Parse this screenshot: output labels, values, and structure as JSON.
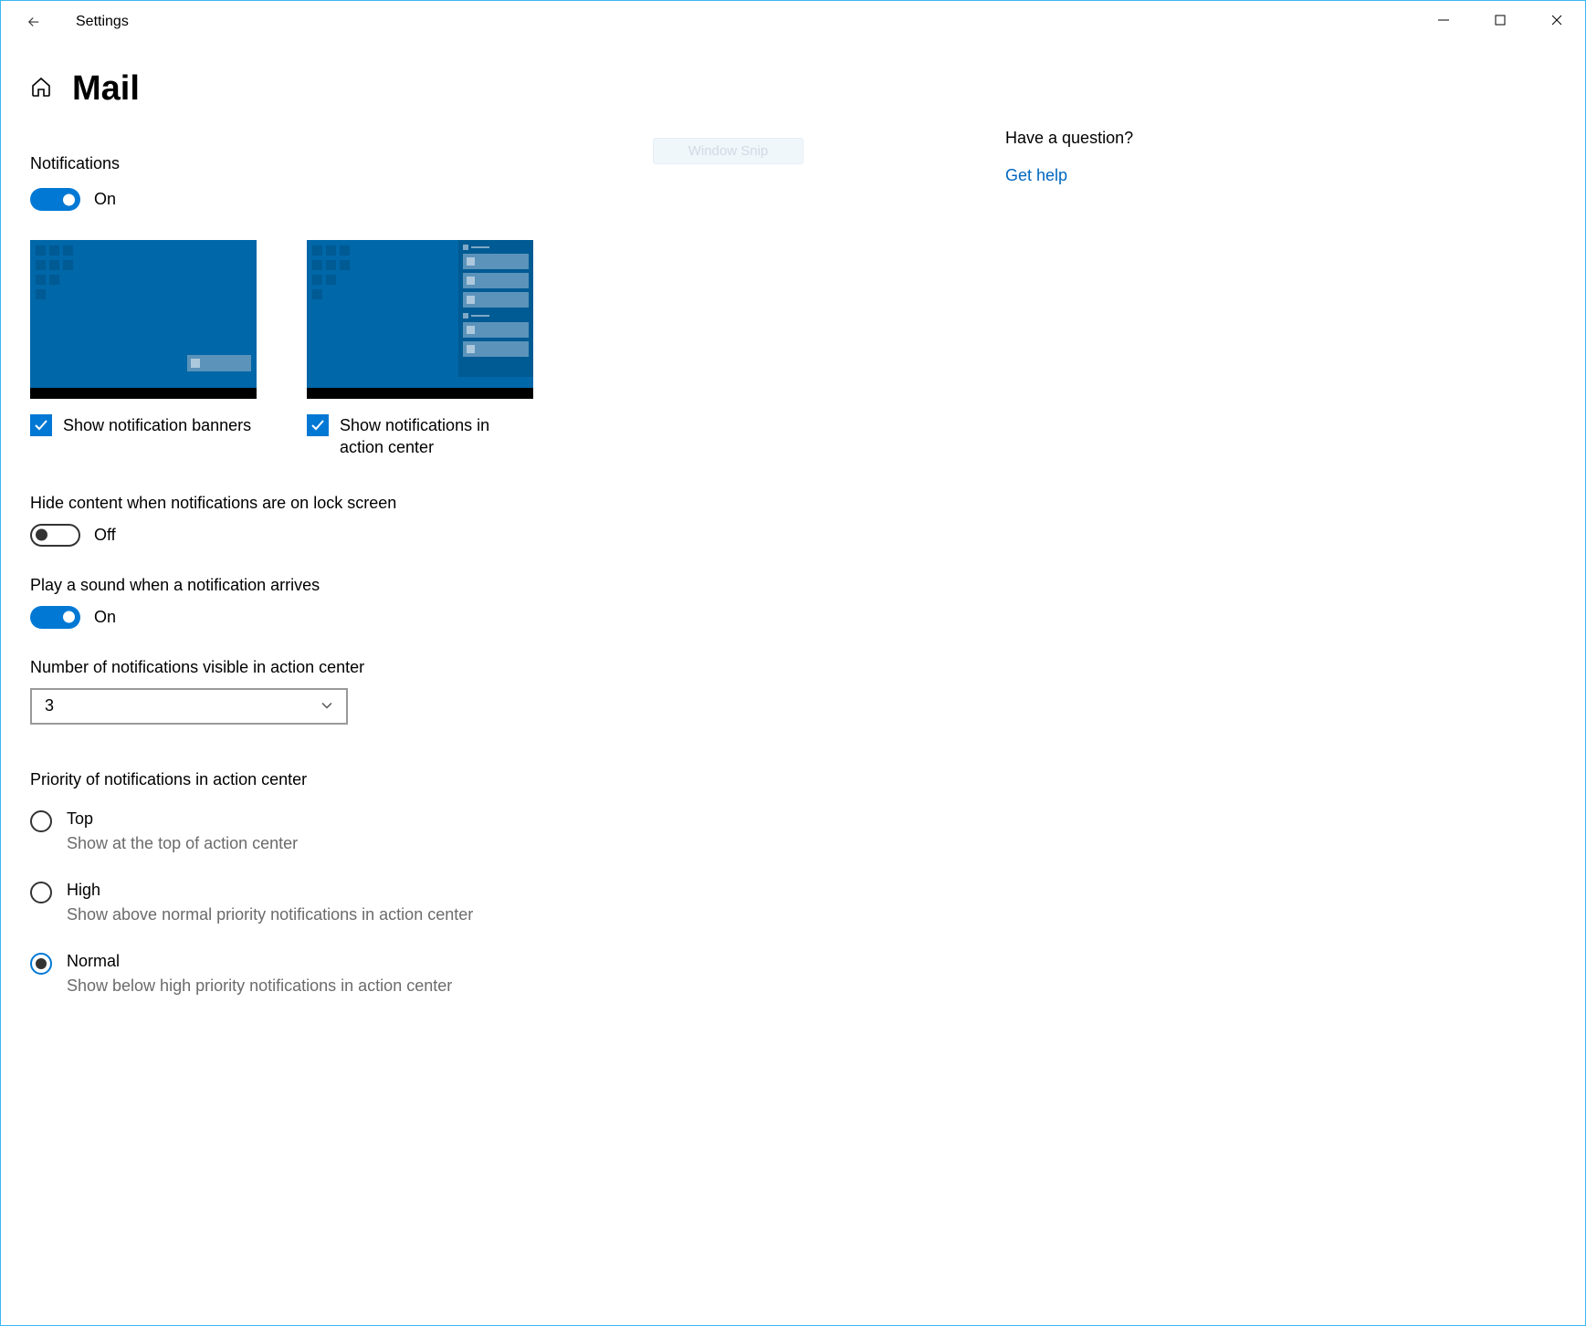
{
  "window": {
    "title": "Settings"
  },
  "page": {
    "title": "Mail"
  },
  "notifications": {
    "heading": "Notifications",
    "toggle_state": "On",
    "show_banners_label": "Show notification banners",
    "show_action_center_label": "Show notifications in action center"
  },
  "hide_content": {
    "label": "Hide content when notifications are on lock screen",
    "state": "Off"
  },
  "play_sound": {
    "label": "Play a sound when a notification arrives",
    "state": "On"
  },
  "visible_count": {
    "label": "Number of notifications visible in action center",
    "value": "3"
  },
  "priority": {
    "heading": "Priority of notifications in action center",
    "options": [
      {
        "title": "Top",
        "desc": "Show at the top of action center",
        "selected": false
      },
      {
        "title": "High",
        "desc": "Show above normal priority notifications in action center",
        "selected": false
      },
      {
        "title": "Normal",
        "desc": "Show below high priority notifications in action center",
        "selected": true
      }
    ]
  },
  "help": {
    "heading": "Have a question?",
    "link": "Get help"
  },
  "ghost": "Window Snip"
}
